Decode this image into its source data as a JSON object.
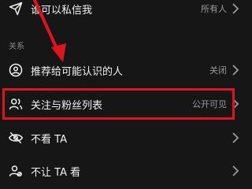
{
  "settings": {
    "rows": [
      {
        "label": "谁可以私信我",
        "value": "所有人",
        "icon": "send-icon"
      },
      {
        "label": "推荐给可能认识的人",
        "value": "关闭",
        "icon": "user-circle-icon"
      },
      {
        "label": "关注与粉丝列表",
        "value": "公开可见",
        "icon": "users-icon"
      },
      {
        "label": "不看 TA",
        "value": "",
        "icon": "eye-off-icon"
      },
      {
        "label": "不让 TA 看",
        "value": "",
        "icon": "user-block-icon"
      }
    ]
  },
  "section": {
    "title": "关系"
  },
  "annotation": {
    "color": "#e0141c"
  },
  "colors": {
    "background": "#161616",
    "text": "#f2f2f2",
    "muted": "#9b9b9b"
  }
}
